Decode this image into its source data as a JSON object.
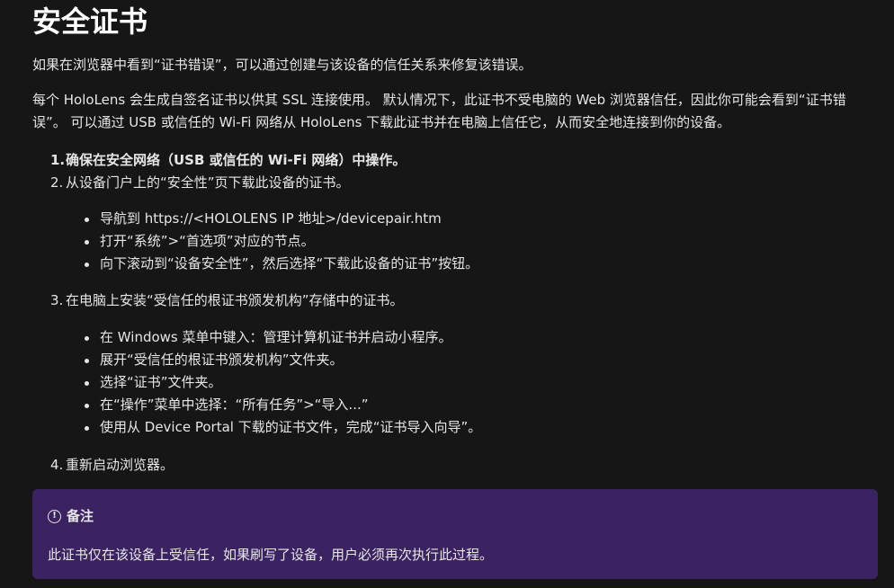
{
  "title": "安全证书",
  "intro": "如果在浏览器中看到“证书错误”，可以通过创建与该设备的信任关系来修复该错误。",
  "description": "每个 HoloLens 会生成自签名证书以供其 SSL 连接使用。 默认情况下，此证书不受电脑的 Web 浏览器信任，因此你可能会看到“证书错误”。 可以通过 USB 或信任的 Wi-Fi 网络从 HoloLens 下载此证书并在电脑上信任它，从而安全地连接到你的设备。",
  "steps": [
    {
      "num": "1.",
      "text": "确保在安全网络（USB 或信任的 Wi-Fi 网络）中操作。"
    },
    {
      "num": "2.",
      "text": "从设备门户上的“安全性”页下载此设备的证书。"
    },
    {
      "num": "3.",
      "text": "在电脑上安装“受信任的根证书颁发机构”存储中的证书。"
    },
    {
      "num": "4.",
      "text": "重新启动浏览器。"
    }
  ],
  "step2_bullets": [
    "导航到 https://<HOLOLENS IP 地址>/devicepair.htm",
    "打开“系统”>“首选项”对应的节点。",
    "向下滚动到“设备安全性”，然后选择“下载此设备的证书”按钮。"
  ],
  "step3_bullets": [
    "在 Windows 菜单中键入：管理计算机证书并启动小程序。",
    "展开“受信任的根证书颁发机构”文件夹。",
    "选择“证书”文件夹。",
    "在“操作”菜单中选择：“所有任务”>“导入...”",
    "使用从 Device Portal 下载的证书文件，完成“证书导入向导”。"
  ],
  "note": {
    "icon": "info-circle-icon",
    "title": "备注",
    "body": "此证书仅在该设备上受信任，如果刷写了设备，用户必须再次执行此过程。"
  },
  "colors": {
    "background": "#161616",
    "text": "#e6e6e6",
    "note_background": "#3b2361"
  }
}
